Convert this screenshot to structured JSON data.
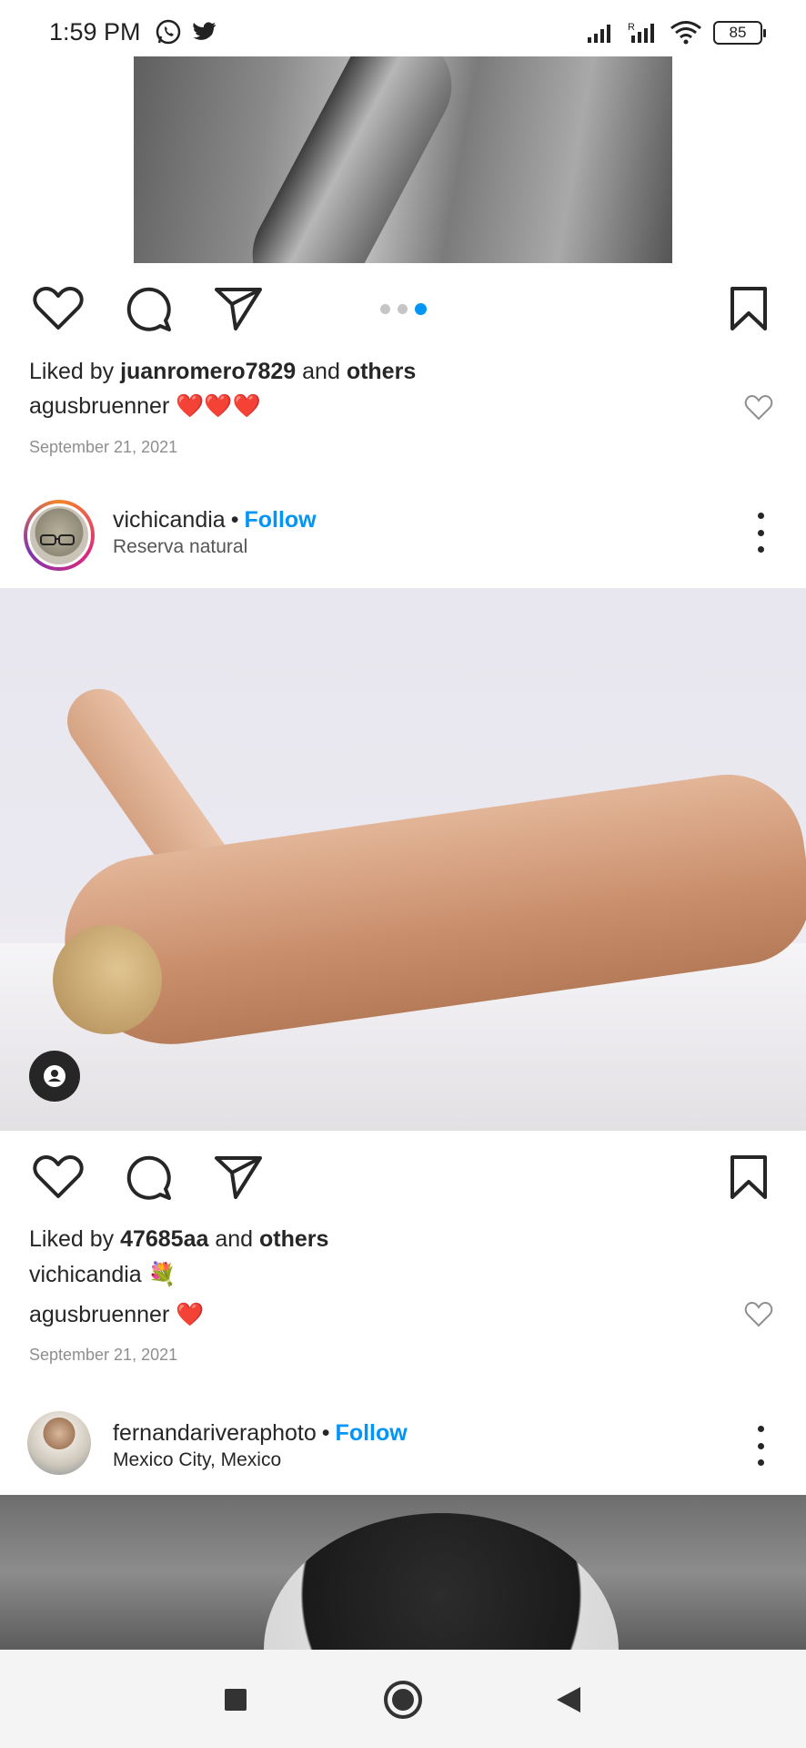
{
  "status_bar": {
    "time": "1:59 PM",
    "battery": "85"
  },
  "post1": {
    "carousel": {
      "count": 3,
      "active_index": 2
    },
    "liked_by_prefix": "Liked by ",
    "liked_by_user": "juanromero7829",
    "liked_by_and": " and ",
    "liked_by_others": "others",
    "comment_user": "agusbruenner",
    "comment_text": "❤️❤️❤️",
    "date": "September 21, 2021"
  },
  "post2": {
    "username": "vichicandia",
    "follow_sep": "•",
    "follow_label": "Follow",
    "location": "Reserva natural",
    "liked_by_prefix": "Liked by ",
    "liked_by_user": "47685aa",
    "liked_by_and": " and ",
    "liked_by_others": "others",
    "caption_user": "vichicandia",
    "caption_text": "💐",
    "comment_user": "agusbruenner",
    "comment_text": "❤️",
    "date": "September 21, 2021"
  },
  "post3": {
    "username": "fernandariveraphoto",
    "follow_sep": "•",
    "follow_label": "Follow",
    "location": "Mexico City, Mexico"
  },
  "icons": {
    "like": "heart-icon",
    "comment": "comment-icon",
    "share": "send-icon",
    "save": "bookmark-icon",
    "more": "more-vertical-icon",
    "tag": "user-tag-icon"
  },
  "colors": {
    "accent": "#0095f6",
    "text": "#262626",
    "muted": "#8e8e8e"
  }
}
